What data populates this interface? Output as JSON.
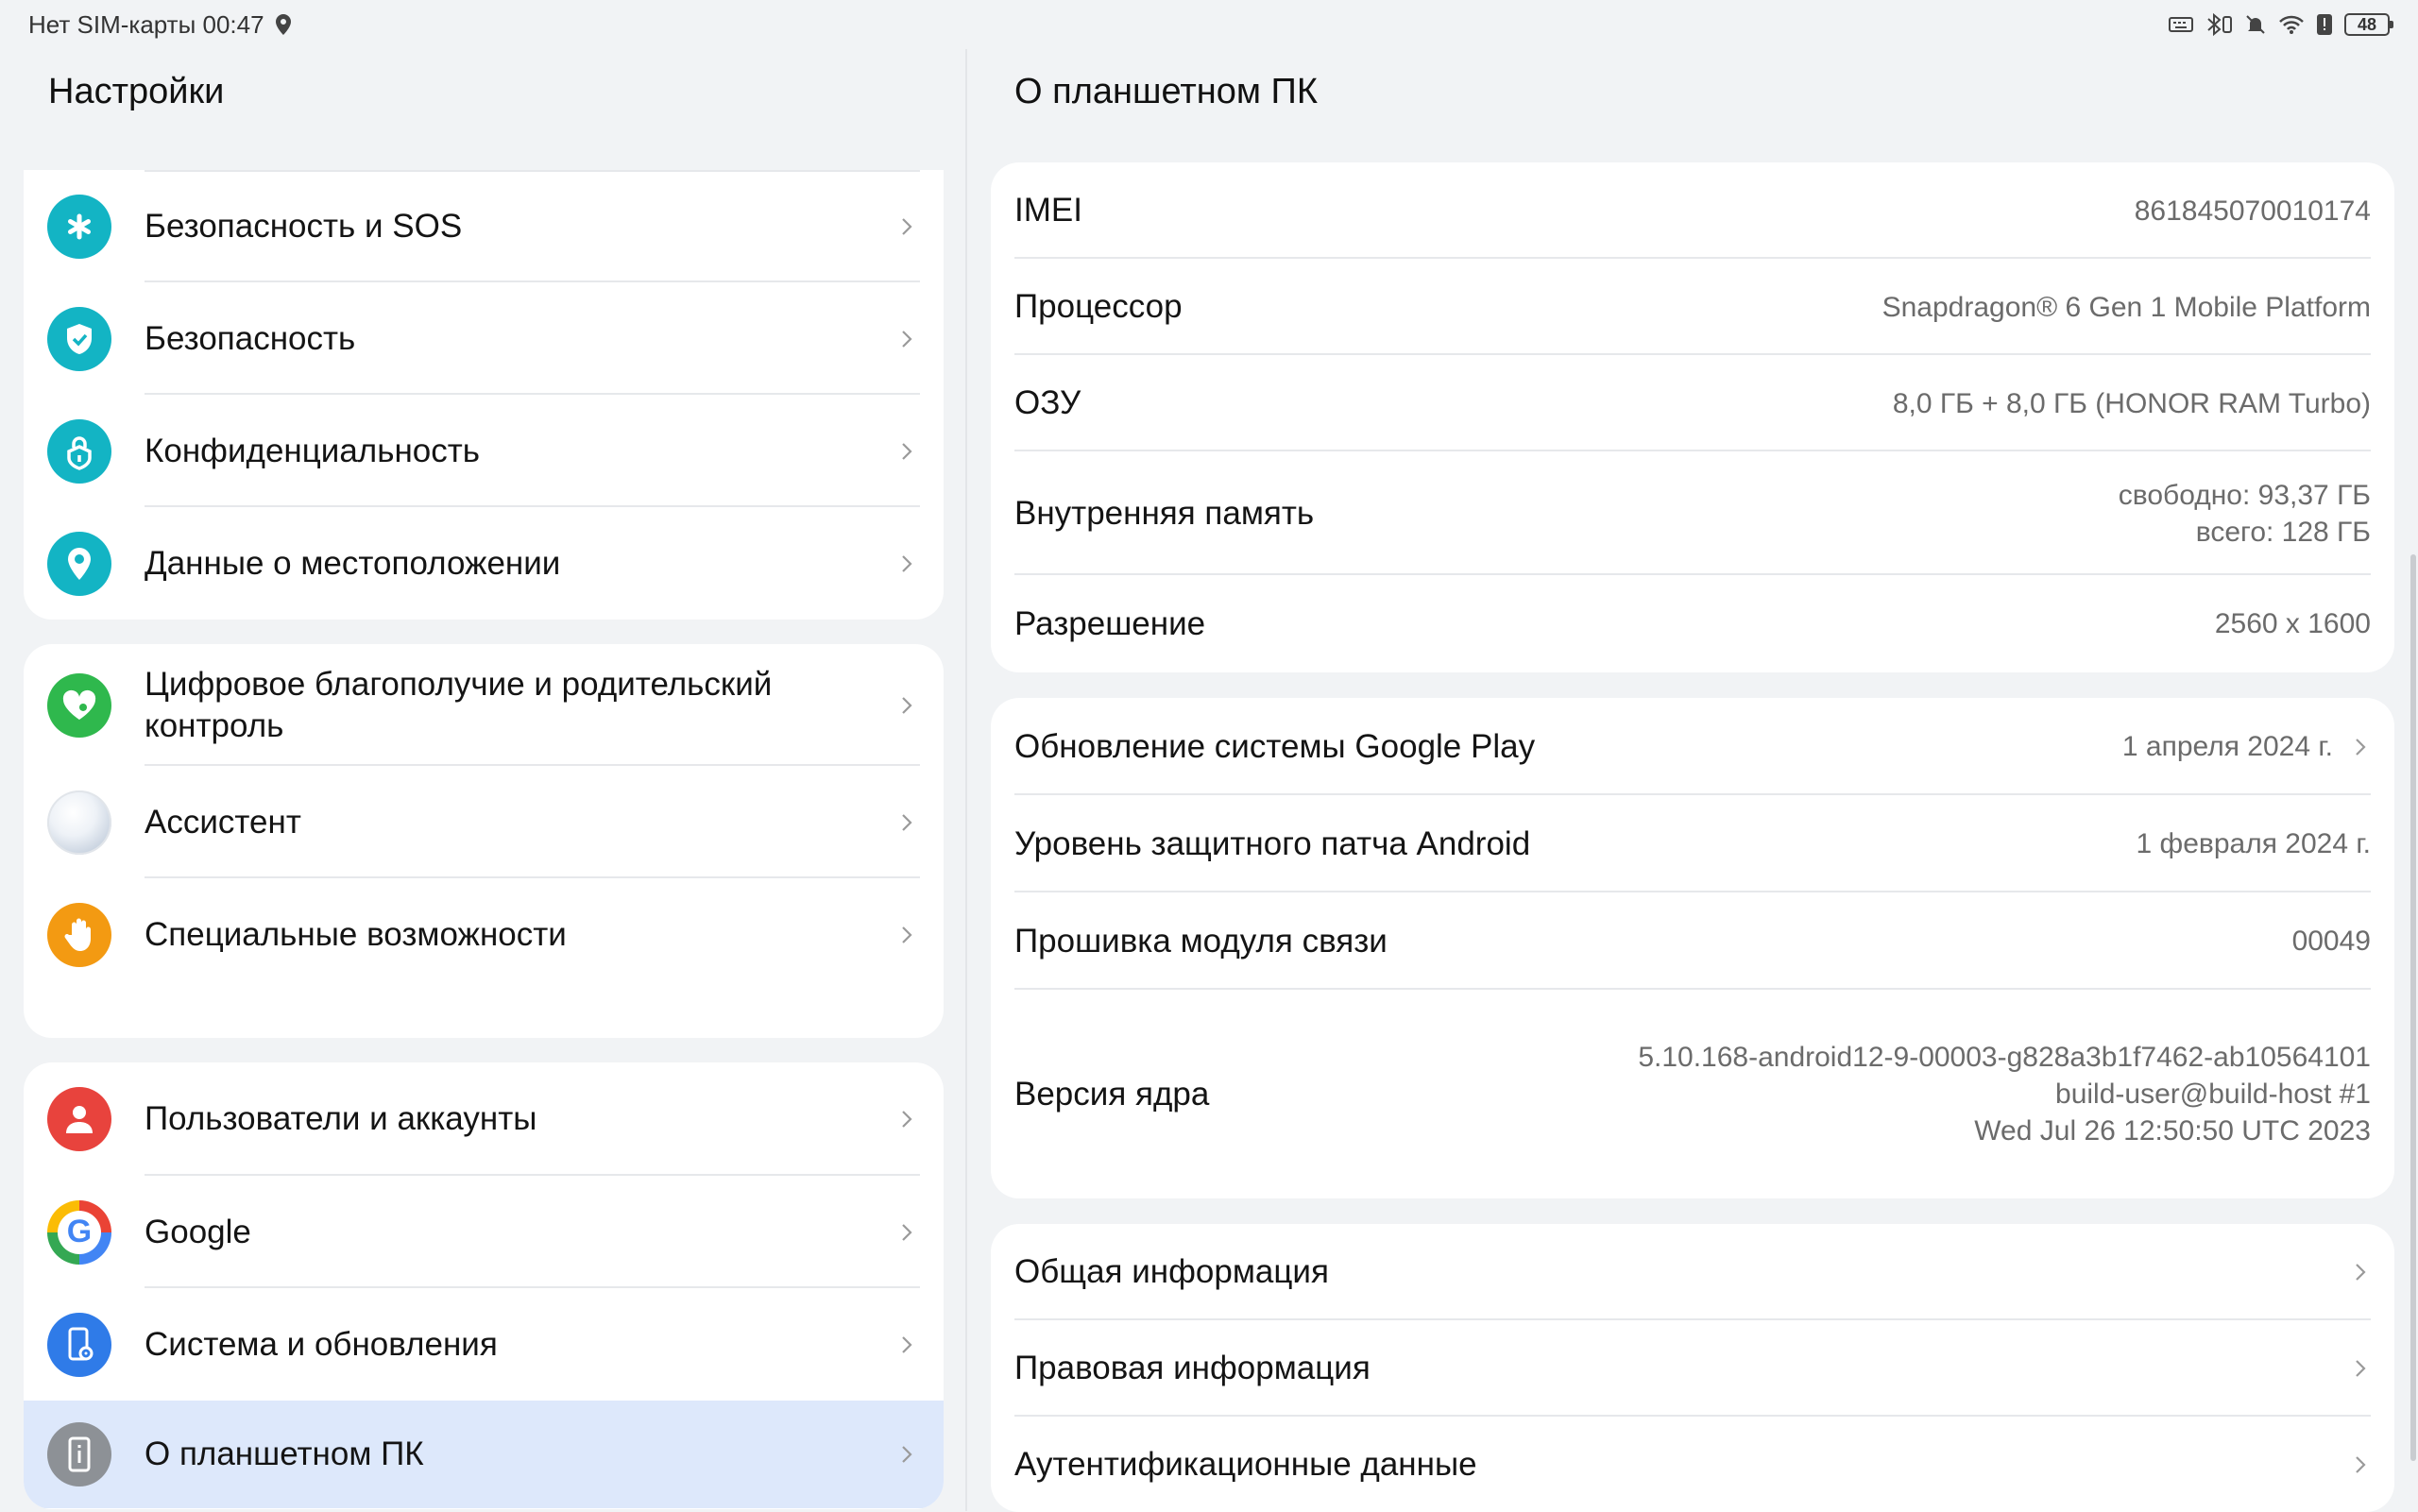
{
  "status_bar": {
    "carrier_time": "Нет SIM-карты 00:47",
    "battery": "48"
  },
  "left": {
    "title": "Настройки",
    "groups": [
      {
        "items": [
          {
            "label": "Безопасность и SOS",
            "icon": "asterisk-icon",
            "color": "#13b4c4"
          },
          {
            "label": "Безопасность",
            "icon": "shield-icon",
            "color": "#13b4c4"
          },
          {
            "label": "Конфиденциальность",
            "icon": "privacy-lock-icon",
            "color": "#13b4c4"
          },
          {
            "label": "Данные о местоположении",
            "icon": "location-pin-icon",
            "color": "#13b4c4"
          }
        ]
      },
      {
        "items": [
          {
            "label": "Цифровое благополучие и родительский контроль",
            "icon": "heart-icon",
            "color": "#2fb84d"
          },
          {
            "label": "Ассистент",
            "icon": "assistant-orb-icon",
            "color": "#d8dde6"
          },
          {
            "label": "Специальные возможности",
            "icon": "hand-icon",
            "color": "#f39a12"
          }
        ]
      },
      {
        "items": [
          {
            "label": "Пользователи и аккаунты",
            "icon": "user-icon",
            "color": "#e8433d"
          },
          {
            "label": "Google",
            "icon": "google-icon",
            "color": "#ffffff"
          },
          {
            "label": "Система и обновления",
            "icon": "phone-gear-icon",
            "color": "#2f7be8"
          },
          {
            "label": "О планшетном ПК",
            "icon": "info-device-icon",
            "color": "#8d9196"
          }
        ]
      }
    ]
  },
  "right": {
    "title": "О планшетном ПК",
    "card1": [
      {
        "key": "IMEI",
        "value": "861845070010174"
      },
      {
        "key": "Процессор",
        "value": "Snapdragon® 6 Gen 1 Mobile Platform"
      },
      {
        "key": "ОЗУ",
        "value": "8,0  ГБ + 8,0 ГБ (HONOR RAM Turbo)"
      },
      {
        "key": "Внутренняя память",
        "value": "свободно: 93,37  ГБ",
        "value2": "всего: 128  ГБ"
      },
      {
        "key": "Разрешение",
        "value": "2560 x 1600"
      }
    ],
    "card2": [
      {
        "key": "Обновление системы Google Play",
        "value": "1 апреля 2024 г."
      },
      {
        "key": "Уровень защитного патча Android",
        "value": "1 февраля 2024 г."
      },
      {
        "key": "Прошивка модуля связи",
        "value": "00049"
      },
      {
        "key": "Версия ядра",
        "value": "5.10.168-android12-9-00003-g828a3b1f7462-ab10564101",
        "value2": "build-user@build-host #1",
        "value3": "Wed Jul 26 12:50:50 UTC 2023"
      }
    ],
    "card3": [
      {
        "key": "Общая информация"
      },
      {
        "key": "Правовая информация"
      },
      {
        "key": "Аутентификационные данные"
      }
    ]
  }
}
